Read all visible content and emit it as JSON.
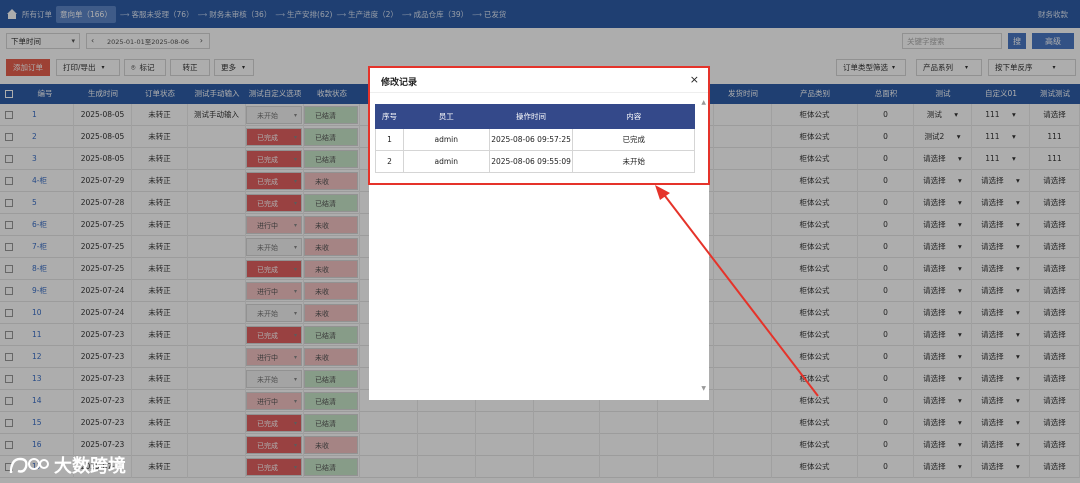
{
  "nav": {
    "items": [
      "所有订单",
      "意向单（166）",
      "客服未受理（76）",
      "财务未审核（36）",
      "生产安排(62)",
      "生产进度（2）",
      "成品仓库（39）",
      "已发货"
    ],
    "right": "财务收款"
  },
  "toolbar": {
    "date_type": "下单时间",
    "date_range": "2025-01-01至2025-08-06",
    "search_placeholder": "关键字搜索",
    "search_btn": "搜",
    "reset_btn": "高级",
    "add_order": "添加订单",
    "print_export": "打印/导出",
    "mark": "标记",
    "convert": "转正",
    "more": "更多",
    "filter_type": "订单类型筛选",
    "product_series": "产品系列",
    "sort": "按下单反序"
  },
  "table": {
    "headers": [
      "编号",
      "生成时间",
      "订单状态",
      "测试手动输入",
      "测试自定义选项",
      "收款状态",
      "发货时间",
      "产品类别",
      "总面积",
      "测试",
      "自定义01",
      "测试测试"
    ],
    "rows": [
      {
        "id": "1",
        "date": "2025-08-05",
        "status": "未转正",
        "manual": "测试手动输入",
        "custom": "未开始",
        "custom_style": "gray",
        "pay": "已结清",
        "pay_style": "green",
        "category": "柜体公式",
        "area": "0",
        "test": "测试",
        "c01": "111",
        "tt": "请选择"
      },
      {
        "id": "2",
        "date": "2025-08-05",
        "status": "未转正",
        "manual": "",
        "custom": "已完成",
        "custom_style": "red",
        "pay": "已结清",
        "pay_style": "green",
        "category": "柜体公式",
        "area": "0",
        "test": "测试2",
        "c01": "111",
        "tt": "111"
      },
      {
        "id": "3",
        "date": "2025-08-05",
        "status": "未转正",
        "manual": "",
        "custom": "已完成",
        "custom_style": "red",
        "pay": "已结清",
        "pay_style": "green",
        "category": "柜体公式",
        "area": "0",
        "test": "请选择",
        "c01": "111",
        "tt": "111"
      },
      {
        "id": "4-柜",
        "date": "2025-07-29",
        "status": "未转正",
        "manual": "",
        "custom": "已完成",
        "custom_style": "red",
        "pay": "未收",
        "pay_style": "pink",
        "category": "柜体公式",
        "area": "0",
        "test": "请选择",
        "c01": "请选择",
        "tt": "请选择"
      },
      {
        "id": "5",
        "date": "2025-07-28",
        "status": "未转正",
        "manual": "",
        "custom": "已完成",
        "custom_style": "red",
        "pay": "已结清",
        "pay_style": "green",
        "category": "柜体公式",
        "area": "0",
        "test": "请选择",
        "c01": "请选择",
        "tt": "请选择"
      },
      {
        "id": "6-柜",
        "date": "2025-07-25",
        "status": "未转正",
        "manual": "",
        "custom": "进行中",
        "custom_style": "pink",
        "pay": "未收",
        "pay_style": "pink",
        "category": "柜体公式",
        "area": "0",
        "test": "请选择",
        "c01": "请选择",
        "tt": "请选择"
      },
      {
        "id": "7-柜",
        "date": "2025-07-25",
        "status": "未转正",
        "manual": "",
        "custom": "未开始",
        "custom_style": "gray",
        "pay": "未收",
        "pay_style": "pink",
        "category": "柜体公式",
        "area": "0",
        "test": "请选择",
        "c01": "请选择",
        "tt": "请选择"
      },
      {
        "id": "8-柜",
        "date": "2025-07-25",
        "status": "未转正",
        "manual": "",
        "custom": "已完成",
        "custom_style": "red",
        "pay": "未收",
        "pay_style": "pink",
        "category": "柜体公式",
        "area": "0",
        "test": "请选择",
        "c01": "请选择",
        "tt": "请选择"
      },
      {
        "id": "9-柜",
        "date": "2025-07-24",
        "status": "未转正",
        "manual": "",
        "custom": "进行中",
        "custom_style": "pink",
        "pay": "未收",
        "pay_style": "pink",
        "category": "柜体公式",
        "area": "0",
        "test": "请选择",
        "c01": "请选择",
        "tt": "请选择"
      },
      {
        "id": "10",
        "date": "2025-07-24",
        "status": "未转正",
        "manual": "",
        "custom": "未开始",
        "custom_style": "gray",
        "pay": "未收",
        "pay_style": "pink",
        "category": "柜体公式",
        "area": "0",
        "test": "请选择",
        "c01": "请选择",
        "tt": "请选择"
      },
      {
        "id": "11",
        "date": "2025-07-23",
        "status": "未转正",
        "manual": "",
        "custom": "已完成",
        "custom_style": "red",
        "pay": "已结清",
        "pay_style": "green",
        "category": "柜体公式",
        "area": "0",
        "test": "请选择",
        "c01": "请选择",
        "tt": "请选择"
      },
      {
        "id": "12",
        "date": "2025-07-23",
        "status": "未转正",
        "manual": "",
        "custom": "进行中",
        "custom_style": "pink",
        "pay": "未收",
        "pay_style": "pink",
        "category": "柜体公式",
        "area": "0",
        "test": "请选择",
        "c01": "请选择",
        "tt": "请选择"
      },
      {
        "id": "13",
        "date": "2025-07-23",
        "status": "未转正",
        "manual": "",
        "custom": "未开始",
        "custom_style": "gray",
        "pay": "已结清",
        "pay_style": "green",
        "category": "柜体公式",
        "area": "0",
        "test": "请选择",
        "c01": "请选择",
        "tt": "请选择"
      },
      {
        "id": "14",
        "date": "2025-07-23",
        "status": "未转正",
        "manual": "",
        "custom": "进行中",
        "custom_style": "pink",
        "pay": "已结清",
        "pay_style": "green",
        "category": "柜体公式",
        "area": "0",
        "test": "请选择",
        "c01": "请选择",
        "tt": "请选择"
      },
      {
        "id": "15",
        "date": "2025-07-23",
        "status": "未转正",
        "manual": "",
        "custom": "已完成",
        "custom_style": "red",
        "pay": "已结清",
        "pay_style": "green",
        "category": "柜体公式",
        "area": "0",
        "test": "请选择",
        "c01": "请选择",
        "tt": "请选择"
      },
      {
        "id": "16",
        "date": "2025-07-23",
        "status": "未转正",
        "manual": "",
        "custom": "已完成",
        "custom_style": "red",
        "pay": "未收",
        "pay_style": "pink",
        "category": "柜体公式",
        "area": "0",
        "test": "请选择",
        "c01": "请选择",
        "tt": "请选择"
      },
      {
        "id": "17",
        "date": "2025-07-23",
        "status": "未转正",
        "manual": "",
        "custom": "已完成",
        "custom_style": "red",
        "pay": "已结清",
        "pay_style": "green",
        "category": "柜体公式",
        "area": "0",
        "test": "请选择",
        "c01": "请选择",
        "tt": "请选择"
      }
    ]
  },
  "modal": {
    "title": "修改记录",
    "close": "×",
    "headers": [
      "序号",
      "员工",
      "操作时间",
      "内容"
    ],
    "rows": [
      {
        "no": "1",
        "staff": "admin",
        "time": "2025-08-06 09:57:25",
        "content": "已完成"
      },
      {
        "no": "2",
        "staff": "admin",
        "time": "2025-08-06 09:55:09",
        "content": "未开始"
      }
    ]
  },
  "watermark": "大数跨境",
  "colors": {
    "nav_bg": "#2f5ea8",
    "modal_header": "#34498a",
    "annotation": "#e5332a",
    "status_red": "#e26060",
    "status_green": "#c8e6c9"
  }
}
